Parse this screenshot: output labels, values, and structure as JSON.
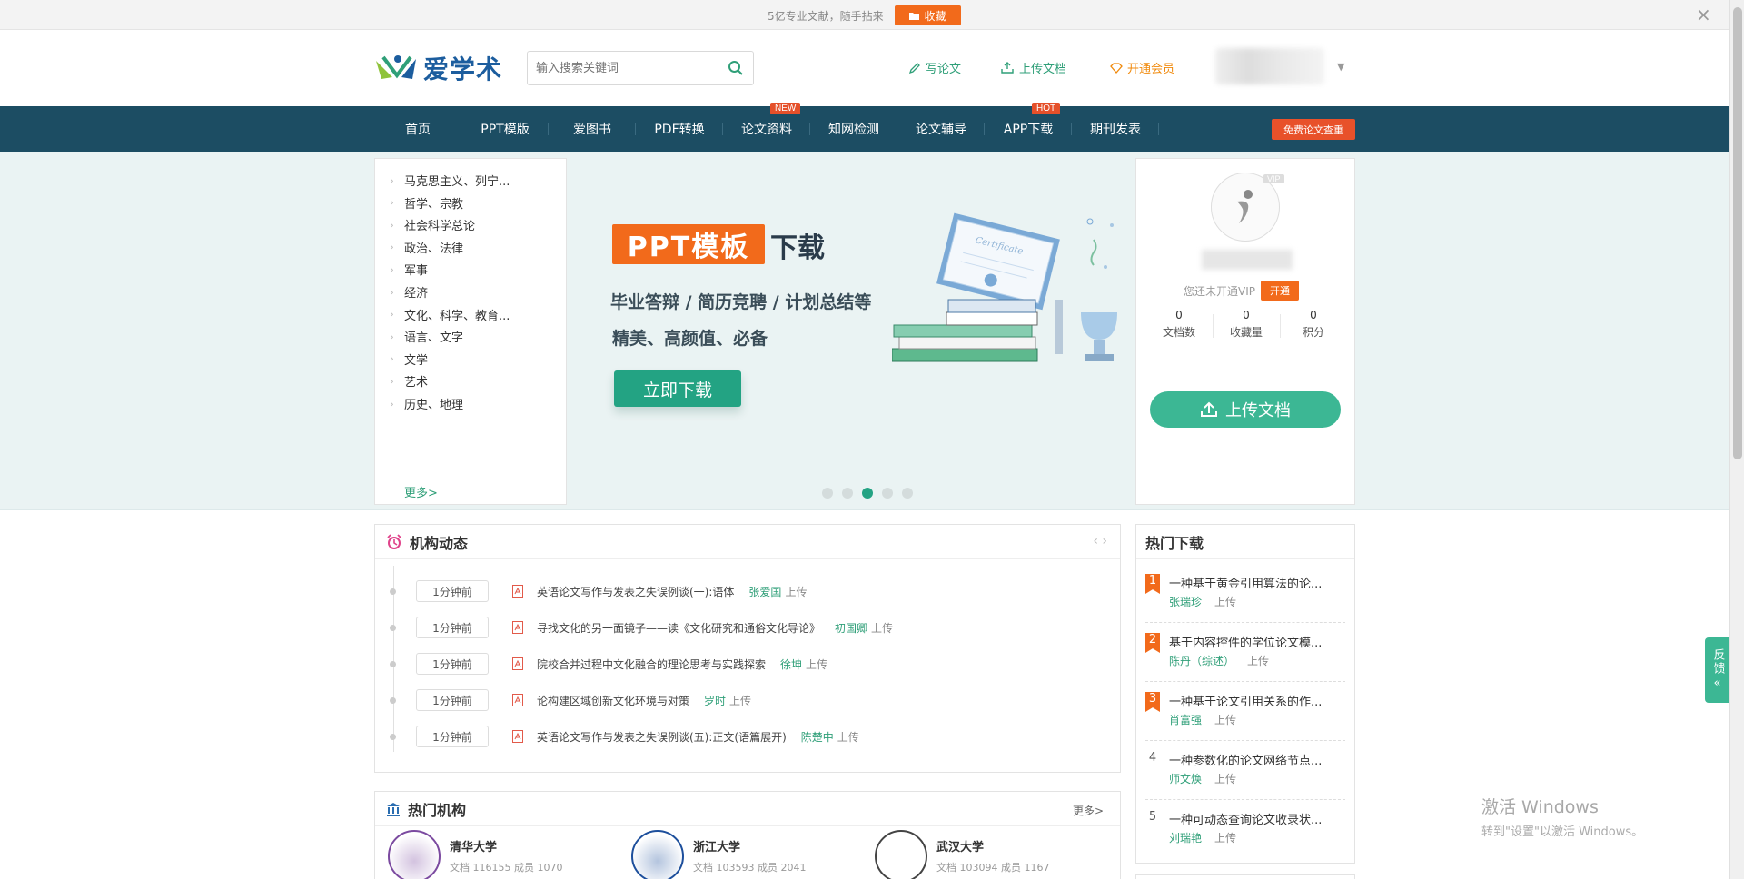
{
  "topbar": {
    "notice": "5亿专业文献，随手拈来",
    "fav_label": "收藏"
  },
  "header": {
    "logo_text": "爱学术",
    "search_placeholder": "输入搜索关键词",
    "links": {
      "write": "写论文",
      "upload": "上传文档",
      "vip": "开通会员"
    }
  },
  "nav": {
    "items": [
      {
        "label": "首页",
        "badge": ""
      },
      {
        "label": "PPT模版",
        "badge": ""
      },
      {
        "label": "爱图书",
        "badge": ""
      },
      {
        "label": "PDF转换",
        "badge": ""
      },
      {
        "label": "论文资料",
        "badge": "NEW"
      },
      {
        "label": "知网检测",
        "badge": ""
      },
      {
        "label": "论文辅导",
        "badge": ""
      },
      {
        "label": "APP下载",
        "badge": "HOT"
      },
      {
        "label": "期刊发表",
        "badge": ""
      }
    ],
    "cta": "免费论文查重"
  },
  "categories": {
    "items": [
      "马克思主义、列宁...",
      "哲学、宗教",
      "社会科学总论",
      "政治、法律",
      "军事",
      "经济",
      "文化、科学、教育...",
      "语言、文字",
      "文学",
      "艺术",
      "历史、地理"
    ],
    "more": "更多>"
  },
  "banner": {
    "tag": "PPT模板",
    "tag_suffix": "下载",
    "line1": "毕业答辩 / 简历竞聘 / 计划总结等",
    "line2": "精美、高颜值、必备",
    "button": "立即下载",
    "slide_count": 5,
    "active_slide": 3
  },
  "user_panel": {
    "vip_badge": "VIP",
    "vip_status": "您还未开通VIP",
    "open_label": "开通",
    "stats": [
      {
        "value": "0",
        "label": "文档数"
      },
      {
        "value": "0",
        "label": "收藏量"
      },
      {
        "value": "0",
        "label": "积分"
      }
    ],
    "upload_label": "上传文档"
  },
  "activity": {
    "title": "机构动态",
    "rows": [
      {
        "time": "1分钟前",
        "title": "英语论文写作与发表之失误例谈(一):语体",
        "author": "张爱国",
        "action": "上传"
      },
      {
        "time": "1分钟前",
        "title": "寻找文化的另一面镜子——读《文化研究和通俗文化导论》",
        "author": "初国卿",
        "action": "上传"
      },
      {
        "time": "1分钟前",
        "title": "院校合并过程中文化融合的理论思考与实践探索",
        "author": "徐坤",
        "action": "上传"
      },
      {
        "time": "1分钟前",
        "title": "论构建区域创新文化环境与对策",
        "author": "罗时",
        "action": "上传"
      },
      {
        "time": "1分钟前",
        "title": "英语论文写作与发表之失误例谈(五):正文(语篇展开)",
        "author": "陈楚中",
        "action": "上传"
      }
    ]
  },
  "hot": {
    "title": "热门下载",
    "items": [
      {
        "rank": "1",
        "title": "一种基于黄金引用算法的论...",
        "author": "张瑞珍",
        "action": "上传"
      },
      {
        "rank": "2",
        "title": "基于内容控件的学位论文模...",
        "author": "陈丹（综述）",
        "action": "上传"
      },
      {
        "rank": "3",
        "title": "一种基于论文引用关系的作...",
        "author": "肖富强",
        "action": "上传"
      },
      {
        "rank": "4",
        "title": "一种参数化的论文网络节点...",
        "author": "师文焕",
        "action": "上传"
      },
      {
        "rank": "5",
        "title": "一种可动态查询论文收录状...",
        "author": "刘瑞艳",
        "action": "上传"
      }
    ]
  },
  "institutions": {
    "title": "热门机构",
    "more": "更多>",
    "items": [
      {
        "name": "清华大学",
        "stat": "文档 116155  成员 1070"
      },
      {
        "name": "浙江大学",
        "stat": "文档 103593  成员 2041"
      },
      {
        "name": "武汉大学",
        "stat": "文档 103094  成员 1167"
      }
    ]
  },
  "feedback": {
    "label": "反馈"
  },
  "watermark": {
    "line1": "激活 Windows",
    "line2": "转到\"设置\"以激活 Windows。"
  },
  "colors": {
    "brand_green": "#2f9f78",
    "nav_bg": "#1c4d63",
    "accent_orange": "#f26a1b"
  }
}
